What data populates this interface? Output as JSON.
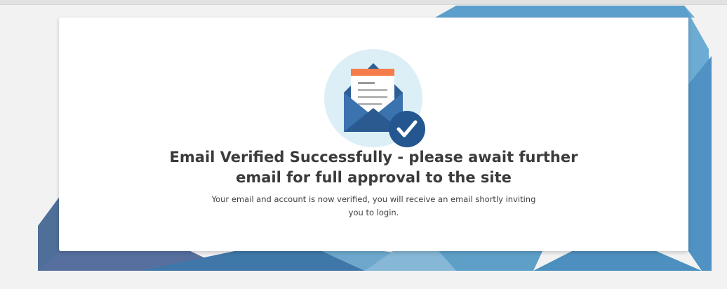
{
  "verification": {
    "headline": "Email Verified Successfully - please await further email for full approval to the site",
    "message": "Your email and account is now verified, you will receive an email shortly inviting you to login."
  },
  "illustration": {
    "icon": "envelope-letter-icon",
    "badge_icon": "checkmark-icon",
    "letter_header_color": "#f47d4a",
    "envelope_color": "#2d5f95",
    "circle_color": "#dceef6"
  },
  "colors": {
    "page_background": "#f2f2f2",
    "card_background": "#ffffff",
    "text_primary": "#3b3b3b",
    "accent_blue": "#2b5e95"
  }
}
